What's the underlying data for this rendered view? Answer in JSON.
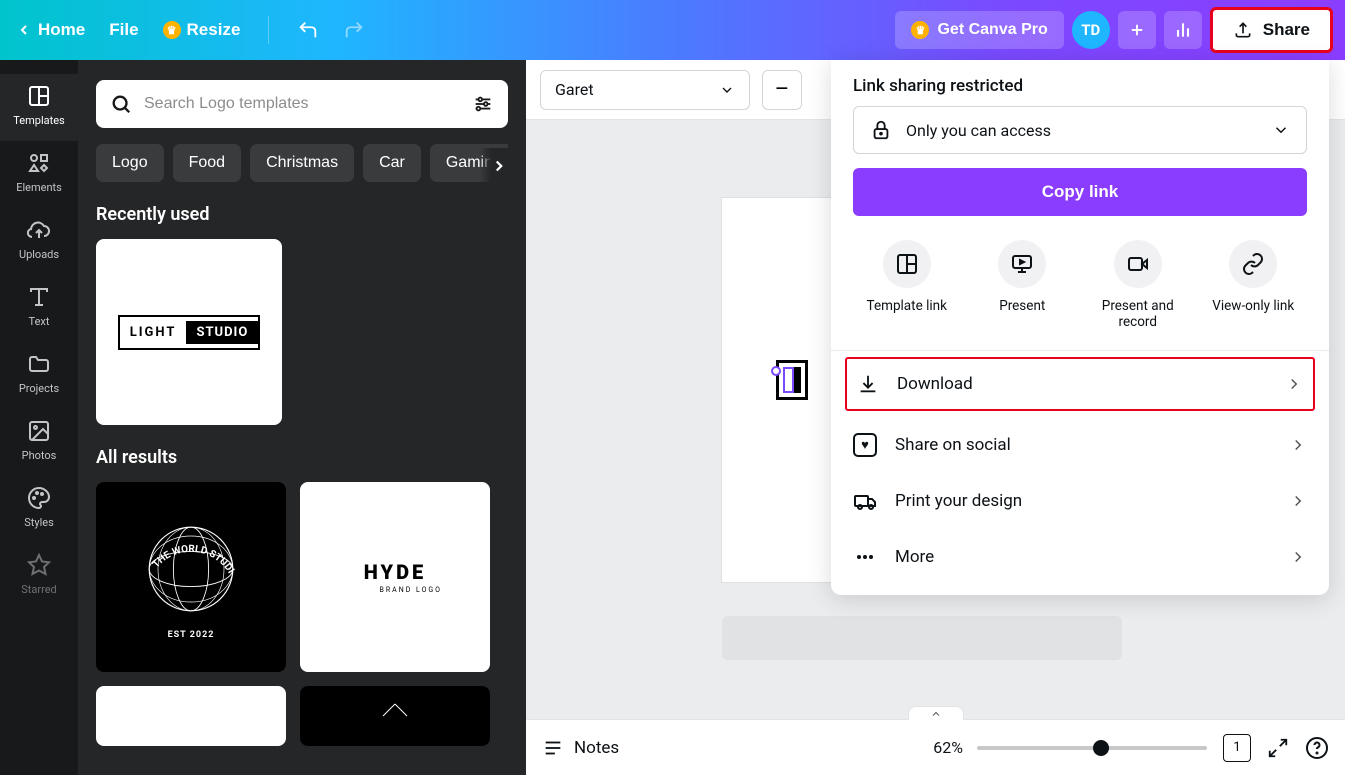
{
  "topbar": {
    "home": "Home",
    "file": "File",
    "resize": "Resize",
    "getpro": "Get Canva Pro",
    "avatar": "TD",
    "share": "Share"
  },
  "rail": {
    "templates": "Templates",
    "elements": "Elements",
    "uploads": "Uploads",
    "text": "Text",
    "projects": "Projects",
    "photos": "Photos",
    "styles": "Styles",
    "starred": "Starred"
  },
  "panel": {
    "search_placeholder": "Search Logo templates",
    "chips": [
      "Logo",
      "Food",
      "Christmas",
      "Car",
      "Gaming"
    ],
    "recently_used": "Recently used",
    "all_results": "All results",
    "logo1_left": "LIGHT",
    "logo1_right": "STUDIO",
    "world_top": "THE WORLD STUDIOS",
    "world_est": "EST 2022",
    "hyde": "HYDE",
    "hyde_sub": "BRAND LOGO"
  },
  "toolbar": {
    "font": "Garet",
    "minus": "–"
  },
  "share": {
    "title": "Link sharing restricted",
    "access": "Only you can access",
    "copy": "Copy link",
    "template_link": "Template link",
    "present": "Present",
    "present_record": "Present and record",
    "view_only": "View-only link",
    "download": "Download",
    "share_social": "Share on social",
    "print": "Print your design",
    "more": "More"
  },
  "bottombar": {
    "notes": "Notes",
    "zoom": "62%",
    "page": "1"
  }
}
